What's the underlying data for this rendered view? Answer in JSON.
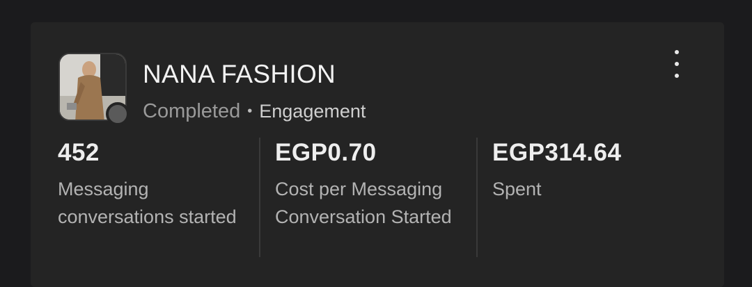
{
  "campaign": {
    "name": "NANA FASHION",
    "status": "Completed",
    "separator": "•",
    "objective": "Engagement",
    "status_color": "#5a5a5a",
    "thumbnail_icon": "product-photo"
  },
  "menu": {
    "icon": "more-vertical-icon"
  },
  "metrics": [
    {
      "value": "452",
      "label": "Messaging conversations started"
    },
    {
      "value": "EGP0.70",
      "label": "Cost per Messaging Conversation Started"
    },
    {
      "value": "EGP314.64",
      "label": "Spent"
    }
  ]
}
